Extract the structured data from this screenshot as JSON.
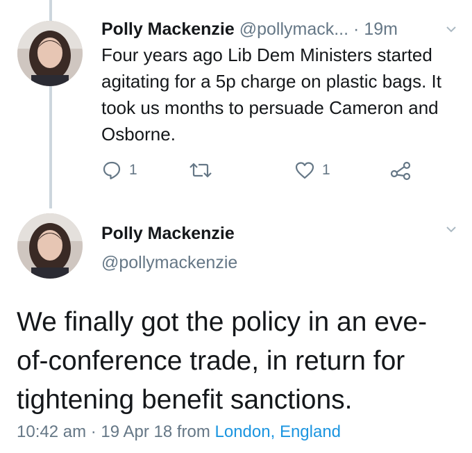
{
  "tweet1": {
    "author_name": "Polly Mackenzie",
    "handle": "@pollymack...",
    "separator": "·",
    "time": "19m",
    "text": "Four years ago Lib Dem Ministers started agitating for a 5p charge on plastic bags. It took us months to persuade Cameron and Osborne.",
    "reply_count": "1",
    "retweet_count": "",
    "like_count": "1",
    "icons": [
      "reply-icon",
      "retweet-icon",
      "like-icon",
      "share-icon",
      "chevron-down-icon"
    ]
  },
  "tweet2": {
    "author_name": "Polly Mackenzie",
    "handle": "@pollymackenzie",
    "text": "We finally got the policy in an eve-of-conference trade, in return for tightening benefit sanctions.",
    "time": "10:42 am",
    "separator": "·",
    "date": "19 Apr 18",
    "from_label": "from",
    "location": "London, England"
  },
  "colors": {
    "primary_text": "#14171a",
    "secondary_text": "#657786",
    "link": "#1b95e0",
    "thread_line": "#ccd6dd"
  }
}
